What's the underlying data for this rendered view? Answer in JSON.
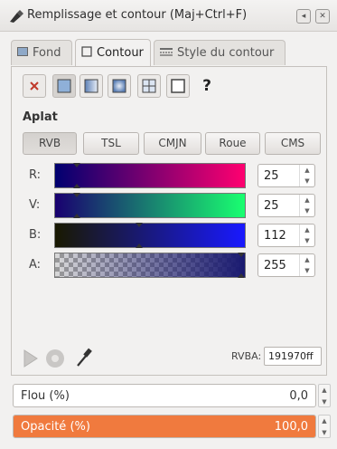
{
  "window": {
    "title": "Remplissage et contour (Maj+Ctrl+F)"
  },
  "tabs": [
    {
      "label": "Fond"
    },
    {
      "label": "Contour"
    },
    {
      "label": "Style du contour"
    }
  ],
  "paint": {
    "unset_label": "?"
  },
  "section_label": "Aplat",
  "modes": [
    "RVB",
    "TSL",
    "CMJN",
    "Roue",
    "CMS"
  ],
  "channels": [
    {
      "label": "R:",
      "value": "25"
    },
    {
      "label": "V:",
      "value": "25"
    },
    {
      "label": "B:",
      "value": "112"
    },
    {
      "label": "A:",
      "value": "255"
    }
  ],
  "rgba": {
    "label": "RVBA:",
    "value": "191970ff"
  },
  "blur": {
    "label": "Flou (%)",
    "value": "0,0"
  },
  "opacity": {
    "label": "Opacité (%)",
    "value": "100,0",
    "fraction": 1.0
  },
  "colors": {
    "current": "#191970",
    "accent": "#f07a3e"
  }
}
